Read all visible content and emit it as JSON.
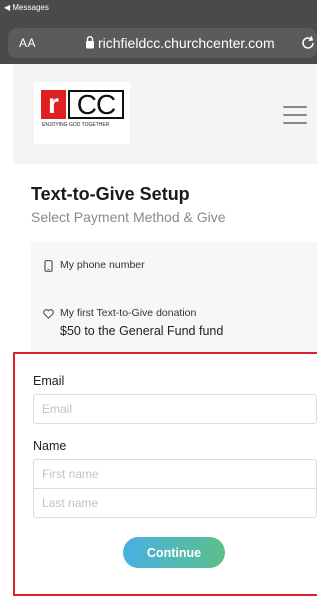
{
  "browser": {
    "back_label": "◀ Messages",
    "aa_label": "AA",
    "url": "richfieldcc.churchcenter.com"
  },
  "logo": {
    "letter": "r",
    "letters": "CC",
    "tagline": "ENJOYING GOD TOGETHER",
    "brand_color": "#e02020"
  },
  "page": {
    "title": "Text-to-Give Setup",
    "subtitle": "Select Payment Method & Give"
  },
  "summary": {
    "phone_label": "My phone number",
    "donation_label": "My first Text-to-Give donation",
    "donation_detail": "$50 to the General Fund fund"
  },
  "form": {
    "email_label": "Email",
    "email_placeholder": "Email",
    "name_label": "Name",
    "first_name_placeholder": "First name",
    "last_name_placeholder": "Last name",
    "continue_label": "Continue",
    "highlight_color": "#d8232a"
  },
  "icons": {
    "lock": "lock-icon",
    "reload": "reload-icon",
    "menu": "hamburger-menu-icon",
    "phone": "phone-icon",
    "heart": "heart-icon"
  }
}
